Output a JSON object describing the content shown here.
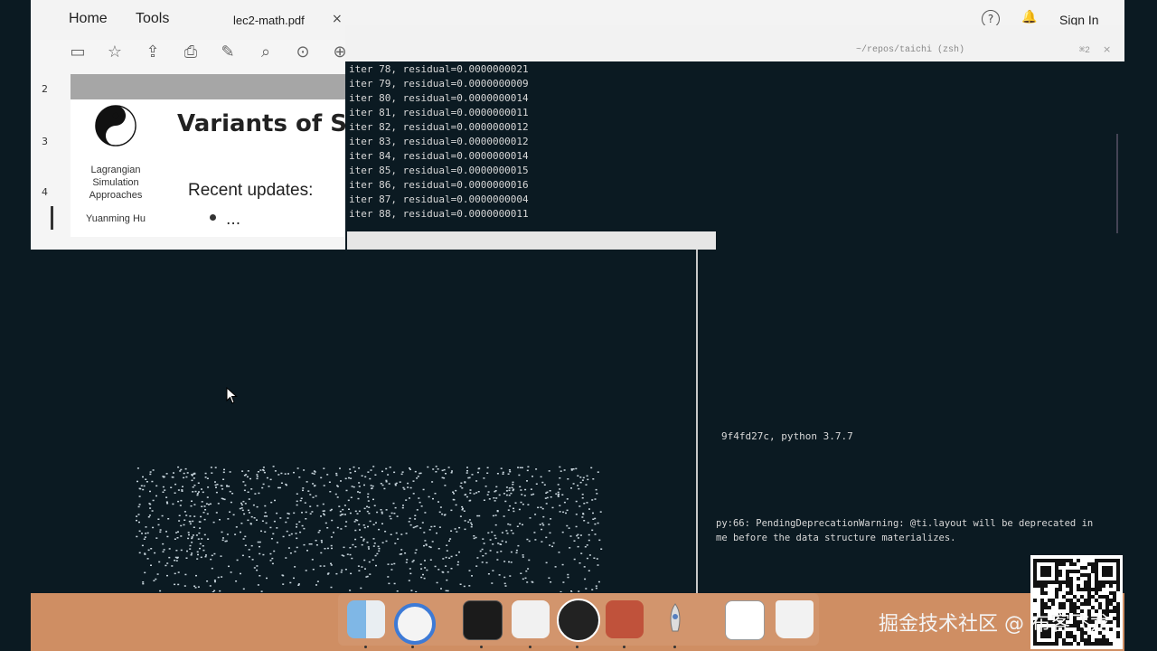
{
  "pdf_viewer": {
    "nav_home": "Home",
    "nav_tools": "Tools",
    "file_tab": "lec2-math.pdf",
    "close_glyph": "×",
    "help_glyph": "?",
    "sign_in": "Sign In",
    "page_numbers": [
      "2",
      "3",
      "4"
    ],
    "slide": {
      "title": "Variants of SP",
      "sidebar_line1": "Lagrangian",
      "sidebar_line2": "Simulation",
      "sidebar_line3": "Approaches",
      "author": "Yuanming Hu",
      "recent_updates": "Recent updates:",
      "ellipsis": "..."
    }
  },
  "terminal": {
    "title": "~/repos/taichi (zsh)",
    "size": "⌘2",
    "close_glyph": "×",
    "lines": [
      "iter 78, residual=0.0000000021",
      "iter 79, residual=0.0000000009",
      "iter 80, residual=0.0000000014",
      "iter 81, residual=0.0000000011",
      "iter 82, residual=0.0000000012",
      "iter 83, residual=0.0000000012",
      "iter 84, residual=0.0000000014",
      "iter 85, residual=0.0000000015",
      "iter 86, residual=0.0000000016",
      "iter 87, residual=0.0000000004",
      "iter 88, residual=0.0000000011"
    ],
    "version_line": "9f4fd27c, python 3.7.7",
    "warning_line1": "py:66: PendingDeprecationWarning: @ti.layout will be deprecated in",
    "warning_line2": "me before the data structure materializes."
  },
  "dock": {
    "items": [
      "finder",
      "chrome",
      "terminal",
      "keynote",
      "obs",
      "acrobat",
      "rocket",
      "qr-app",
      "trash"
    ]
  },
  "watermark": "掘金技术社区 @ 布客飞龙",
  "colors": {
    "dark_bg": "#0b1a22",
    "dock_bg": "#cf8e63",
    "particle": "#c9d6de"
  }
}
